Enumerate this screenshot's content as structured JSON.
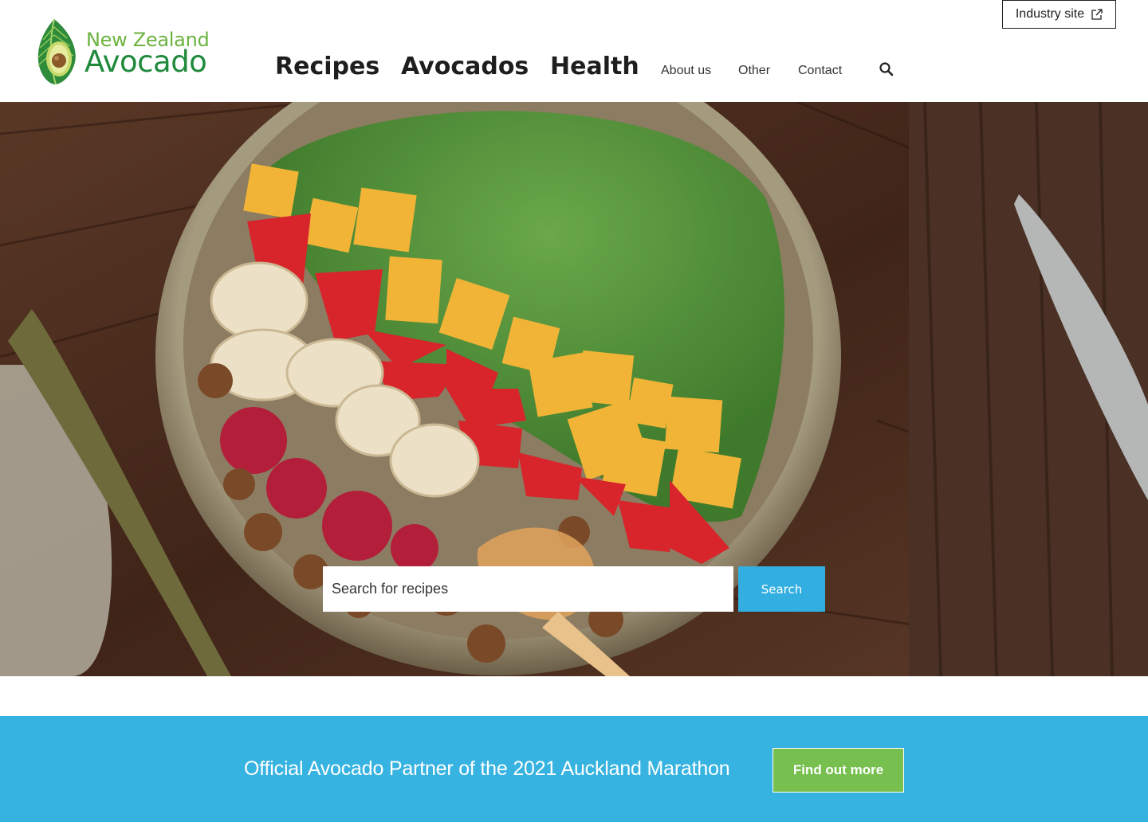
{
  "brand": {
    "line1": "New Zealand",
    "line2": "Avocado",
    "logo_icon": "avocado-leaf-logo"
  },
  "header": {
    "industry_site_label": "Industry site",
    "industry_site_icon": "external-link-icon",
    "nav_main": [
      "Recipes",
      "Avocados",
      "Health"
    ],
    "nav_minor": [
      "About us",
      "Other",
      "Contact"
    ],
    "search_icon": "search-icon"
  },
  "hero": {
    "image": "smoothie bowl with mango, strawberries, banana and granola on a wooden table",
    "search_placeholder": "Search for recipes",
    "search_button": "Search"
  },
  "banner": {
    "text": "Official Avocado Partner of the 2021 Auckland Marathon",
    "button": "Find out more"
  },
  "colors": {
    "brand_green_light": "#6cb33f",
    "brand_green_dark": "#1f8a3c",
    "accent_blue": "#36b3e0",
    "cta_green": "#77bf4e"
  }
}
